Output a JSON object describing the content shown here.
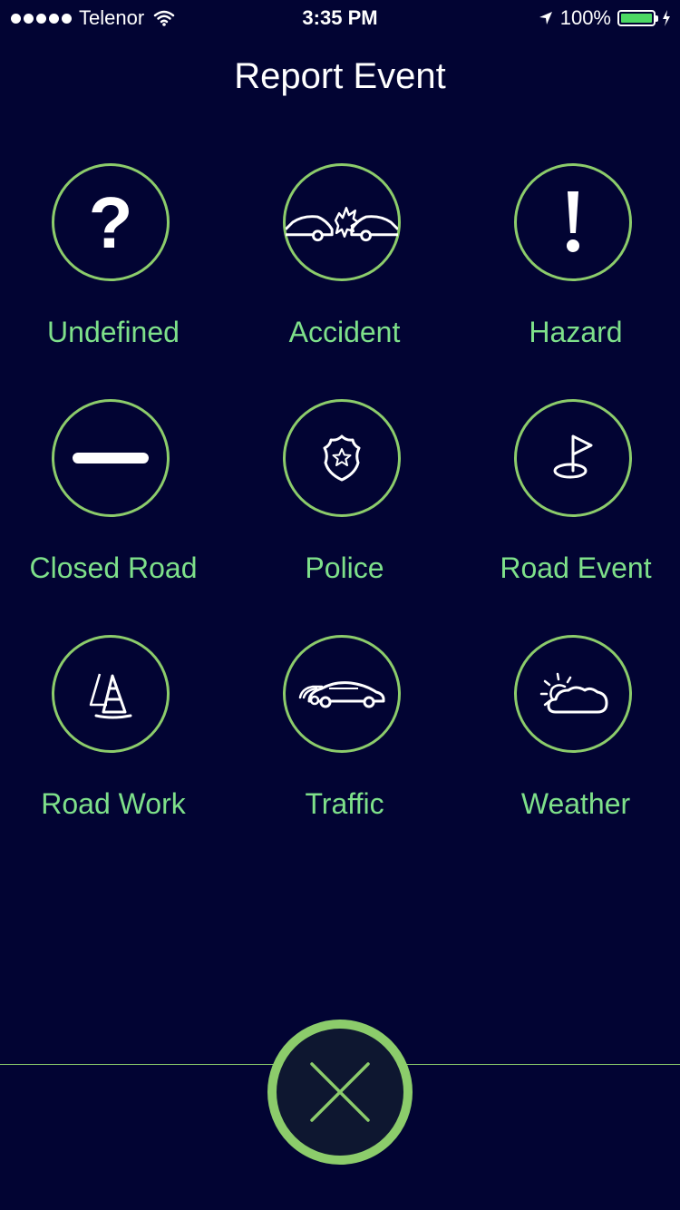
{
  "status_bar": {
    "carrier": "Telenor",
    "time": "3:35 PM",
    "battery": "100%"
  },
  "header": {
    "title": "Report Event"
  },
  "events": [
    {
      "label": "Undefined",
      "icon": "question-icon"
    },
    {
      "label": "Accident",
      "icon": "car-crash-icon"
    },
    {
      "label": "Hazard",
      "icon": "exclamation-icon"
    },
    {
      "label": "Closed Road",
      "icon": "minus-icon"
    },
    {
      "label": "Police",
      "icon": "police-badge-icon"
    },
    {
      "label": "Road Event",
      "icon": "flag-icon"
    },
    {
      "label": "Road Work",
      "icon": "traffic-cone-icon"
    },
    {
      "label": "Traffic",
      "icon": "cars-icon"
    },
    {
      "label": "Weather",
      "icon": "sun-cloud-icon"
    }
  ],
  "colors": {
    "background": "#020433",
    "accent": "#8ccc6b",
    "label": "#7ee08a"
  },
  "close": {
    "icon": "close-icon"
  }
}
